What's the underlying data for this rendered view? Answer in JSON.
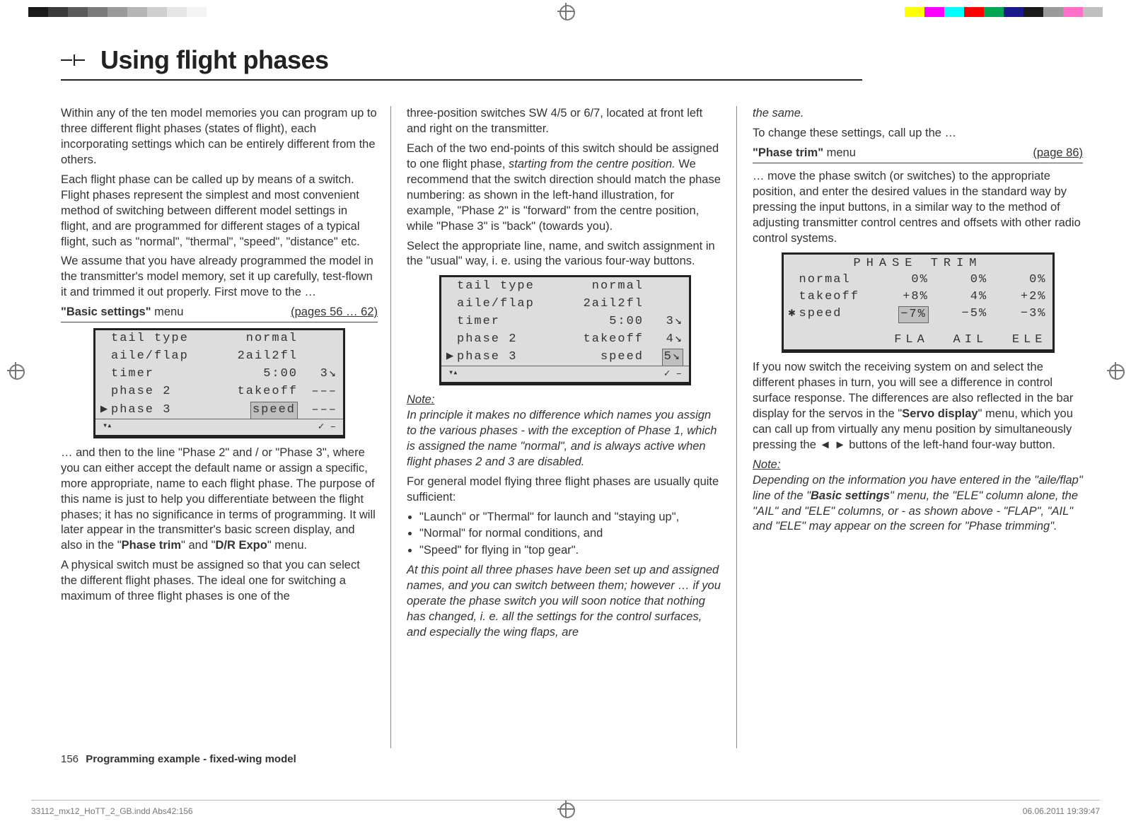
{
  "registration_marks": true,
  "colorbar_left": [
    "#1a1a1a",
    "#3a3a3a",
    "#5a5a5a",
    "#7a7a7a",
    "#9a9a9a",
    "#b5b5b5",
    "#cfcfcf",
    "#e5e5e5",
    "#f3f3f3",
    "#ffffff"
  ],
  "colorbar_right": [
    "#ffff00",
    "#ff00ff",
    "#00ffff",
    "#ff0000",
    "#00a651",
    "#1a1a8a",
    "#1a1a1a",
    "#9a9a9a",
    "#ff6ec7",
    "#bfbfbf"
  ],
  "title": "Using flight phases",
  "col1": {
    "p1": "Within any of the ten model memories you can program up to three different flight phases (states of flight), each incorporating settings which can be entirely different from the others.",
    "p2": "Each flight phase can be called up by means of a switch. Flight phases represent the simplest and most convenient method of switching between different model settings in flight, and are programmed for different stages of a typical flight, such as \"normal\", \"thermal\", \"speed\", \"distance\" etc.",
    "p3": "We assume that you have already programmed the model in the transmitter's model memory, set it up carefully, test-flown it and trimmed it out properly. First move to the …",
    "menuref_left_bold": "\"Basic settings\"",
    "menuref_left_rest": " menu",
    "menuref_right": "(pages 56 … 62)",
    "p4": "… and then to the line \"Phase 2\" and / or \"Phase 3\", where you can either accept the default name or assign a specific, more appropriate, name to each flight phase. The purpose of this name is just to help you differentiate between the flight phases; it has no significance in terms of programming. It will later appear in the transmitter's basic screen display, and also in the \"Phase trim\" and \"D/R Expo\" menu.",
    "p5": "A physical switch must be assigned so that you can select the different flight phases. The ideal one for switching a maximum of three flight phases is one of the"
  },
  "lcd1": {
    "rows": [
      {
        "pt": "",
        "c1": "tail type",
        "c2": "normal",
        "c3": ""
      },
      {
        "pt": "",
        "c1": "aile/flap",
        "c2": "2ail2fl",
        "c3": ""
      },
      {
        "pt": "",
        "c1": "timer",
        "c2": "5:00",
        "c3": "3↘"
      },
      {
        "pt": "",
        "c1": "phase 2",
        "c2": "takeoff",
        "c3": "–––"
      },
      {
        "pt": "▶",
        "c1": "phase 3",
        "c2": "speed",
        "c3": "–––",
        "box2": true
      }
    ],
    "foot_left": "▾▴",
    "foot_right": "✓ –"
  },
  "col2": {
    "p1": "three-position switches SW 4/5 or 6/7, located at front left and right on the transmitter.",
    "p2a": "Each of the two end-points of this switch should be assigned to one flight phase, ",
    "p2b": "starting from the centre position.",
    "p2c": " We recommend that the switch direction should match the phase numbering: as shown in the left-hand illustration, for example, \"Phase 2\" is \"forward\" from the centre position, while \"Phase 3\" is \"back\" (towards you).",
    "p3": "Select the appropriate line, name, and switch assignment in the \"usual\" way, i. e. using the various four-way buttons.",
    "note_label": "Note:",
    "note_body": "In principle it makes no difference which names you assign to the various phases - with the exception of Phase 1, which is assigned the name \"normal\", and is always active when flight phases 2 and 3 are disabled.",
    "p4": "For general model flying three flight phases are usually quite sufficient:",
    "bullets": [
      "\"Launch\" or \"Thermal\" for launch and \"staying up\",",
      "\"Normal\" for normal conditions, and",
      "\"Speed\" for flying in \"top gear\"."
    ],
    "p5": "At this point all three phases have been set up and assigned names, and you can switch between them; however … if you operate the phase switch you will soon notice that nothing has changed, i. e. all the settings for the control surfaces, and especially the wing flaps, are"
  },
  "lcd2": {
    "rows": [
      {
        "pt": "",
        "c1": "tail type",
        "c2": "normal",
        "c3": ""
      },
      {
        "pt": "",
        "c1": "aile/flap",
        "c2": "2ail2fl",
        "c3": ""
      },
      {
        "pt": "",
        "c1": "timer",
        "c2": "5:00",
        "c3": "3↘"
      },
      {
        "pt": "",
        "c1": "phase 2",
        "c2": "takeoff",
        "c3": "4↘"
      },
      {
        "pt": "▶",
        "c1": "phase 3",
        "c2": "speed",
        "c3": "5↘",
        "box3": true
      }
    ],
    "foot_left": "▾▴",
    "foot_right": "✓ –"
  },
  "col3": {
    "p1": "the same.",
    "p2": "To change these settings, call up the …",
    "menuref_left_bold": "\"Phase trim\"",
    "menuref_left_rest": " menu",
    "menuref_right": "(page 86)",
    "p3": "… move the phase switch (or switches) to the appropriate position, and enter the desired values in the standard way by pressing the input buttons, in a similar way to the method of adjusting transmitter control centres and offsets with other radio control systems.",
    "p4a": "If you now switch the receiving system on and select the different phases in turn, you will see a difference in control surface response. The differences are also reflected in the bar display for the servos in the \"",
    "p4b": "Servo display",
    "p4c": "\" menu, which you can call up from virtually any menu position by simultaneously pressing the ◄ ► buttons of the left-hand four-way button.",
    "note_label": "Note:",
    "note_body": "Depending on the information you have entered in the \"aile/flap\" line of the \"Basic settings\" menu, the \"ELE\" column alone, the \"AIL\" and \"ELE\" columns, or - as shown above - \"FLAP\", \"AIL\" and \"ELE\" may appear on the screen for \"Phase trimming\"."
  },
  "lcd3": {
    "header": "PHASE  TRIM",
    "rows": [
      {
        "pt": "",
        "nm": "normal",
        "a": "0%",
        "b": "0%",
        "c": "0%"
      },
      {
        "pt": "",
        "nm": "takeoff",
        "a": "+8%",
        "b": "4%",
        "c": "+2%"
      },
      {
        "pt": "✱",
        "nm": "speed",
        "a": "−7%",
        "b": "−5%",
        "c": "−3%",
        "boxa": true
      }
    ],
    "footer": {
      "a": "FLA",
      "b": "AIL",
      "c": "ELE"
    }
  },
  "footer": {
    "page_num": "156",
    "page_title": "Programming example - fixed-wing model"
  },
  "print": {
    "file": "33112_mx12_HoTT_2_GB.indd   Abs42:156",
    "stamp": "06.06.2011   19:39:47"
  }
}
